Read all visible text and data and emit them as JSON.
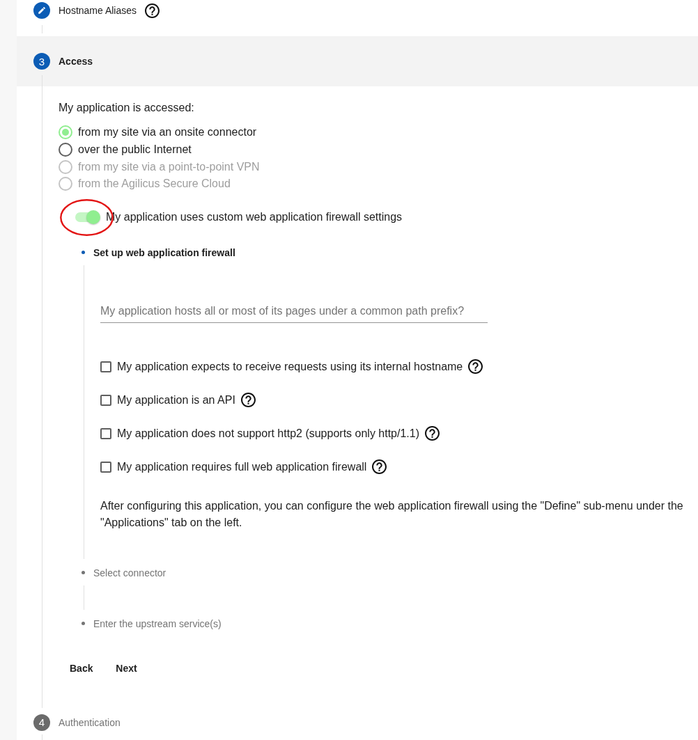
{
  "steps": [
    {
      "kind": "edited",
      "label": "Hostname Aliases",
      "help": true,
      "selected": false
    },
    {
      "kind": "numbered",
      "number": "3",
      "label": "Access",
      "selected": true,
      "access": {
        "prompt": "My application is accessed:",
        "options": [
          {
            "label": "from my site via an onsite connector",
            "selected": true,
            "disabled": false
          },
          {
            "label": "over the public Internet",
            "selected": false,
            "disabled": false
          },
          {
            "label": "from my site via a point-to-point VPN",
            "selected": false,
            "disabled": true
          },
          {
            "label": "from the Agilicus Secure Cloud",
            "selected": false,
            "disabled": true
          }
        ],
        "waf_toggle": {
          "label": "My application uses custom web application firewall settings",
          "on": true,
          "highlighted": true
        },
        "substeps": [
          {
            "label": "Set up web application firewall",
            "selected": true,
            "path_prefix_field": {
              "placeholder": "My application hosts all or most of its pages under a common path prefix?"
            },
            "checkboxes": [
              {
                "label": "My application expects to receive requests using its internal hostname",
                "checked": false,
                "help": true
              },
              {
                "label": "My application is an API",
                "checked": false,
                "help": true
              },
              {
                "label": "My application does not support http2 (supports only http/1.1)",
                "checked": false,
                "help": true
              },
              {
                "label": "My application requires full web application firewall",
                "checked": false,
                "help": true
              }
            ],
            "note": "After configuring this application, you can configure the web application firewall using the \"Define\" sub-menu under the \"Applications\" tab on the left."
          },
          {
            "label": "Select connector",
            "selected": false
          },
          {
            "label": "Enter the upstream service(s)",
            "selected": false
          }
        ],
        "buttons": [
          "Back",
          "Next"
        ]
      }
    },
    {
      "kind": "numbered",
      "number": "4",
      "label": "Authentication",
      "selected": false
    }
  ]
}
